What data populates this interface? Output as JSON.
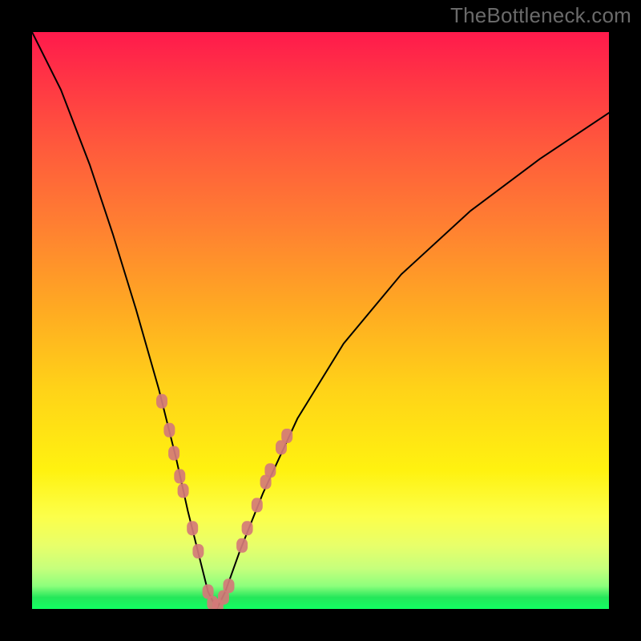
{
  "watermark": "TheBottleneck.com",
  "colors": {
    "curve": "#000000",
    "marker": "#d47a78",
    "gradient_top": "#ff1a4c",
    "gradient_yellow": "#fff210",
    "gradient_green": "#12ff62"
  },
  "chart_data": {
    "type": "line",
    "title": "",
    "xlabel": "",
    "ylabel": "",
    "xlim": [
      0,
      100
    ],
    "ylim": [
      0,
      100
    ],
    "notch_x": 32,
    "series": [
      {
        "name": "bottleneck-curve",
        "x": [
          0,
          5,
          10,
          14,
          18,
          22,
          25,
          27,
          29,
          30.5,
          32,
          33.5,
          36,
          40,
          46,
          54,
          64,
          76,
          88,
          100
        ],
        "values": [
          100,
          90,
          77,
          65,
          52,
          38,
          26,
          17,
          9,
          3,
          0,
          3,
          10,
          20,
          33,
          46,
          58,
          69,
          78,
          86
        ]
      }
    ],
    "markers": [
      {
        "x": 22.5,
        "y": 36
      },
      {
        "x": 23.8,
        "y": 31
      },
      {
        "x": 24.6,
        "y": 27
      },
      {
        "x": 25.6,
        "y": 23
      },
      {
        "x": 26.2,
        "y": 20.5
      },
      {
        "x": 27.8,
        "y": 14
      },
      {
        "x": 28.8,
        "y": 10
      },
      {
        "x": 30.5,
        "y": 3
      },
      {
        "x": 31.3,
        "y": 1
      },
      {
        "x": 32.2,
        "y": 0.5
      },
      {
        "x": 33.2,
        "y": 2
      },
      {
        "x": 34.1,
        "y": 4
      },
      {
        "x": 36.4,
        "y": 11
      },
      {
        "x": 37.3,
        "y": 14
      },
      {
        "x": 39.0,
        "y": 18
      },
      {
        "x": 40.5,
        "y": 22
      },
      {
        "x": 41.3,
        "y": 24
      },
      {
        "x": 43.2,
        "y": 28
      },
      {
        "x": 44.2,
        "y": 30
      }
    ]
  }
}
